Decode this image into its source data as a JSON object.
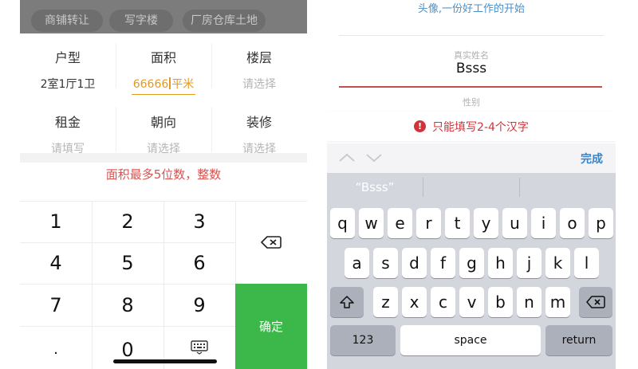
{
  "left": {
    "chips": [
      "商铺转让",
      "写字楼",
      "厂房仓库土地"
    ],
    "fields": [
      {
        "label": "户型",
        "value": "2室1厅1卫",
        "placeholder": ""
      },
      {
        "label": "面积",
        "value": "66666",
        "unit": "平米",
        "placeholder": ""
      },
      {
        "label": "楼层",
        "value": "",
        "placeholder": "请选择"
      },
      {
        "label": "租金",
        "value": "",
        "placeholder": "请填写"
      },
      {
        "label": "朝向",
        "value": "",
        "placeholder": "请选择"
      },
      {
        "label": "装修",
        "value": "",
        "placeholder": "请选择"
      }
    ],
    "error": "面积最多5位数，整数",
    "keys": [
      "1",
      "2",
      "3",
      "4",
      "5",
      "6",
      "7",
      "8",
      "9",
      ".",
      "0"
    ],
    "confirm_label": "确定",
    "icons": [
      "backspace-icon",
      "keyboard-icon"
    ],
    "accent_color": "#e39a20",
    "confirm_color": "#3cb84a"
  },
  "right": {
    "top_hint": "头像,一份好工作的开始",
    "name_label": "真实姓名",
    "name_value": "Bsss",
    "gender_label": "性别",
    "error": "只能填写2-4个汉字",
    "error_icon": "!",
    "done_label": "完成",
    "suggestion": "“Bsss”",
    "row1": [
      "q",
      "w",
      "e",
      "r",
      "t",
      "y",
      "u",
      "i",
      "o",
      "p"
    ],
    "row2": [
      "a",
      "s",
      "d",
      "f",
      "g",
      "h",
      "j",
      "k",
      "l"
    ],
    "row3": [
      "z",
      "x",
      "c",
      "v",
      "b",
      "n",
      "m"
    ],
    "numbers_label": "123",
    "space_label": "space",
    "return_label": "return",
    "icons": [
      "chevron-up-icon",
      "chevron-down-icon",
      "shift-icon",
      "delete-icon"
    ],
    "error_color": "#d0343b",
    "done_color": "#3b83c4"
  }
}
